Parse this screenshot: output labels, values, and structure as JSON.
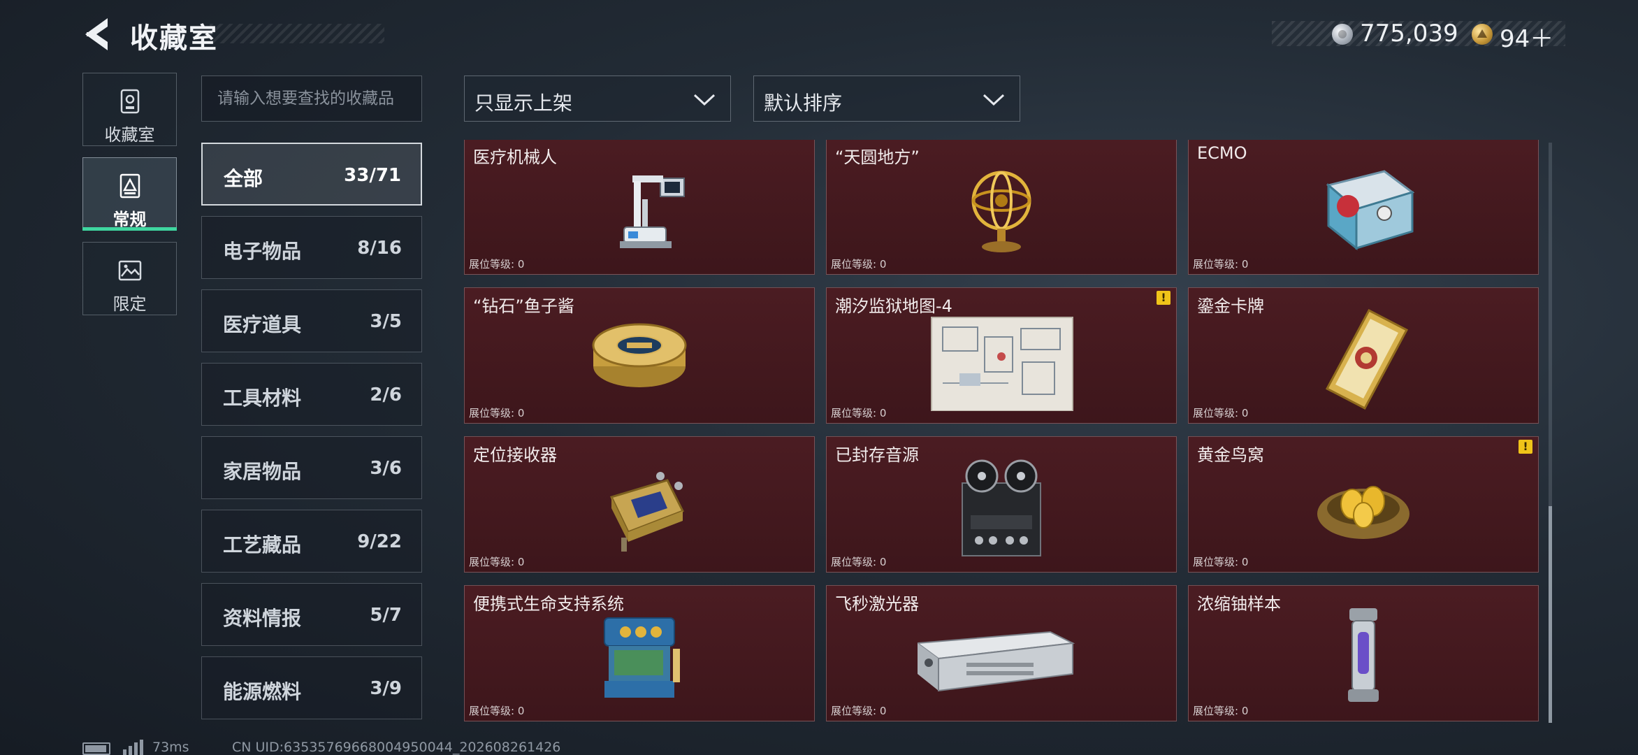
{
  "header": {
    "title": "收藏室",
    "currency_silver": "775,039",
    "currency_gold": "94＋"
  },
  "rail": [
    {
      "label": "收藏室",
      "icon": "vault-icon"
    },
    {
      "label": "常规",
      "icon": "collection-icon"
    },
    {
      "label": "限定",
      "icon": "picture-icon"
    }
  ],
  "search": {
    "placeholder": "请输入想要查找的收藏品",
    "value": ""
  },
  "categories": [
    {
      "label": "全部",
      "count": "33/71"
    },
    {
      "label": "电子物品",
      "count": "8/16"
    },
    {
      "label": "医疗道具",
      "count": "3/5"
    },
    {
      "label": "工具材料",
      "count": "2/6"
    },
    {
      "label": "家居物品",
      "count": "3/6"
    },
    {
      "label": "工艺藏品",
      "count": "9/22"
    },
    {
      "label": "资料情报",
      "count": "5/7"
    },
    {
      "label": "能源燃料",
      "count": "3/9"
    }
  ],
  "filters": {
    "filter_label": "只显示上架",
    "sort_label": "默认排序"
  },
  "items": [
    {
      "name": "医疗机械人",
      "level": "展位等级: 0",
      "icon": "medical-robot-icon"
    },
    {
      "name": "“天圆地方”",
      "level": "展位等级: 0",
      "icon": "armillary-sphere-icon"
    },
    {
      "name": "ECMO",
      "level": "展位等级: 0",
      "icon": "ecmo-machine-icon"
    },
    {
      "name": "“钻石”鱼子酱",
      "level": "展位等级: 0",
      "icon": "caviar-tin-icon"
    },
    {
      "name": "潮汐监狱地图-4",
      "level": "展位等级: 0",
      "icon": "map-icon",
      "alert": "!"
    },
    {
      "name": "鎏金卡牌",
      "level": "展位等级: 0",
      "icon": "gold-card-icon"
    },
    {
      "name": "定位接收器",
      "level": "展位等级: 0",
      "icon": "receiver-icon"
    },
    {
      "name": "已封存音源",
      "level": "展位等级: 0",
      "icon": "tape-recorder-icon"
    },
    {
      "name": "黄金鸟窝",
      "level": "展位等级: 0",
      "icon": "golden-nest-icon",
      "alert": "!"
    },
    {
      "name": "便携式生命支持系统",
      "level": "展位等级: 0",
      "icon": "life-support-icon"
    },
    {
      "name": "飞秒激光器",
      "level": "展位等级: 0",
      "icon": "laser-device-icon"
    },
    {
      "name": "浓缩铀样本",
      "level": "展位等级: 0",
      "icon": "uranium-canister-icon"
    }
  ],
  "footer": {
    "ping": "73ms",
    "uid": "CN UID:635357696680049500​44_202608261426"
  }
}
